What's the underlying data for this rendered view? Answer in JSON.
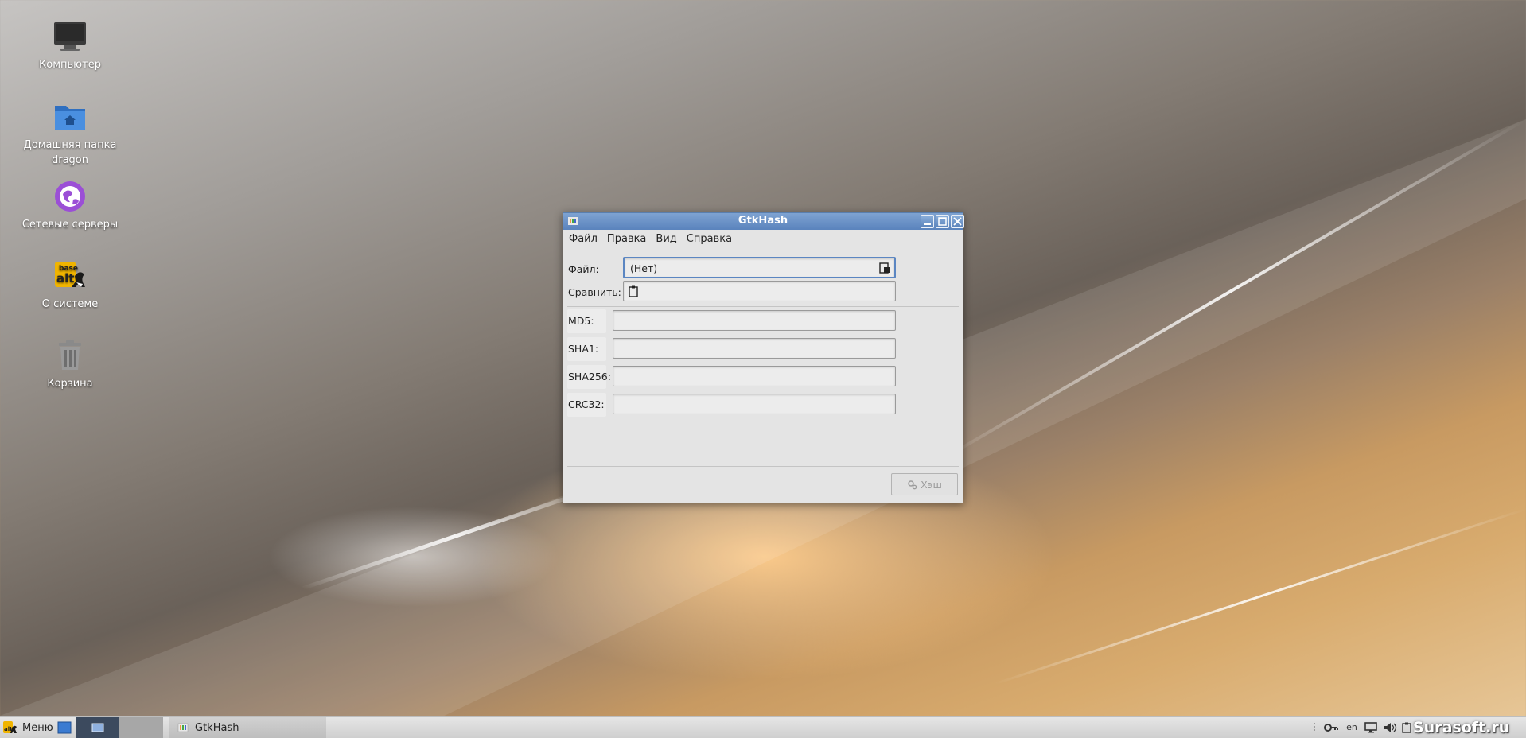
{
  "desktop": {
    "icons": [
      {
        "label": "Компьютер",
        "icon": "computer-icon"
      },
      {
        "label": "Домашняя папка dragon",
        "icon": "home-folder-icon"
      },
      {
        "label": "Сетевые серверы",
        "icon": "network-servers-icon"
      },
      {
        "label": "О системе",
        "icon": "about-system-icon",
        "logo_text": "base alt"
      },
      {
        "label": "Корзина",
        "icon": "trash-icon"
      }
    ]
  },
  "window": {
    "title": "GtkHash",
    "menu": [
      "Файл",
      "Правка",
      "Вид",
      "Справка"
    ],
    "file_label": "Файл:",
    "file_value": "(Нет)",
    "compare_label": "Сравнить:",
    "compare_value": "",
    "hashes": [
      {
        "label": "MD5:",
        "value": ""
      },
      {
        "label": "SHA1:",
        "value": ""
      },
      {
        "label": "SHA256:",
        "value": ""
      },
      {
        "label": "CRC32:",
        "value": ""
      }
    ],
    "hash_button": "Хэш"
  },
  "taskbar": {
    "menu_label": "Меню",
    "task_title": "GtkHash",
    "keyboard_layout": "en",
    "watermark": "Surasoft.ru"
  },
  "colors": {
    "titlebar": "#6a90c6",
    "focus_border": "#5b86c2",
    "taskbar": "#dcdcdc"
  }
}
